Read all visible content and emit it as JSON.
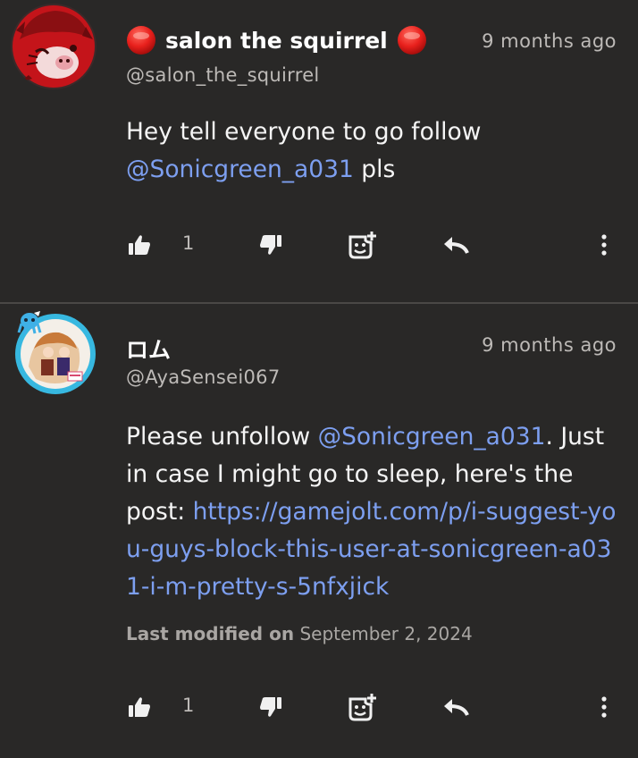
{
  "comments": [
    {
      "author_name": "salon the squirrel",
      "author_badge": "red-circle",
      "handle": "@salon_the_squirrel",
      "time": "9 months ago",
      "text_before": "Hey tell everyone to go follow ",
      "mention": "@Sonicgreen_a031",
      "text_after": " pls",
      "like_count": "1"
    },
    {
      "author_name": "ロム",
      "handle": "@AyaSensei067",
      "time": "9 months ago",
      "text_before": "Please unfollow ",
      "mention": "@Sonicgreen_a031",
      "text_mid": ". Just in case I might go to sleep, here's the post: ",
      "link": "https://gamejolt.com/p/i-suggest-you-guys-block-this-user-at-sonicgreen-a031-i-m-pretty-s-5nfxjick",
      "modified_label": "Last modified on",
      "modified_date": "September 2, 2024",
      "like_count": "1"
    }
  ],
  "colors": {
    "background": "#292827",
    "link": "#7d9ff0",
    "muted": "#bdbab7",
    "badge_red": "#e8201c"
  },
  "icons": [
    "thumbs-up-icon",
    "thumbs-down-icon",
    "sticker-add-icon",
    "reply-icon",
    "more-vertical-icon"
  ]
}
